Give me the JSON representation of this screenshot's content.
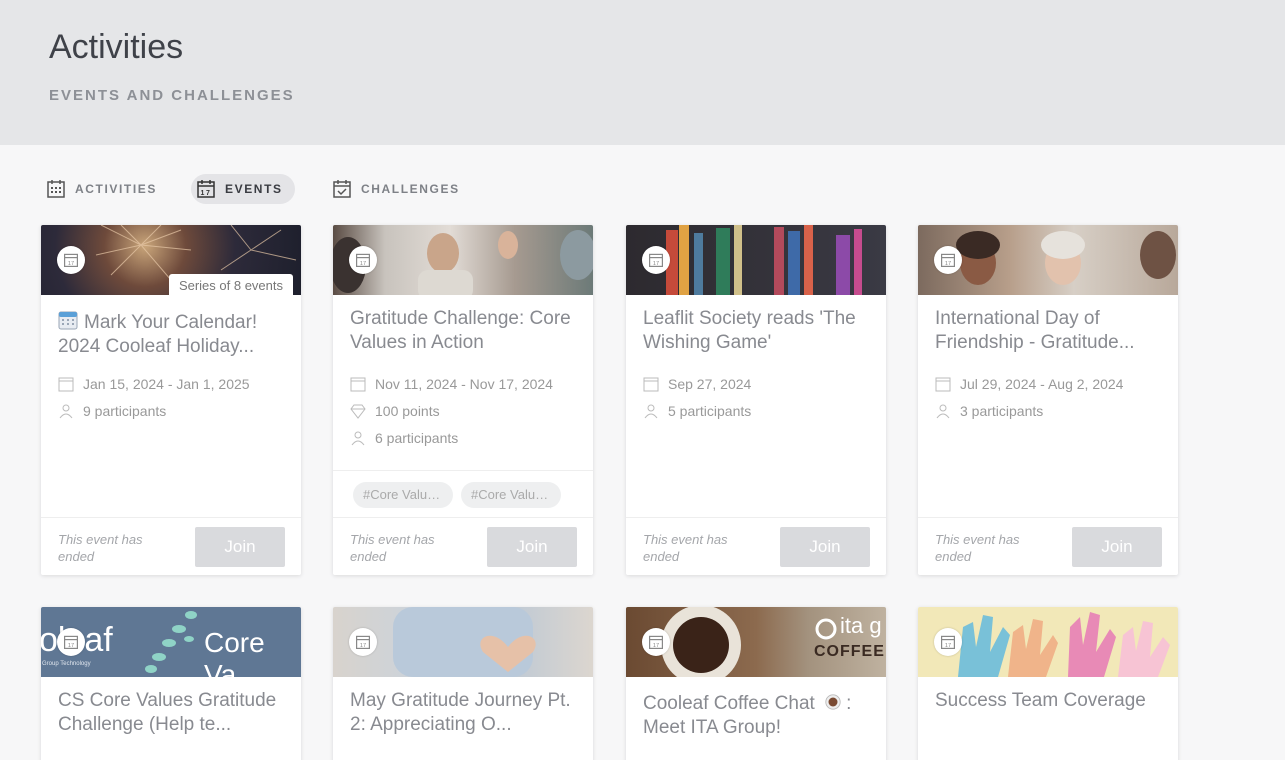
{
  "header": {
    "title": "Activities",
    "subtitle": "EVENTS AND CHALLENGES"
  },
  "tabs": [
    {
      "label": "ACTIVITIES",
      "icon": "grid-calendar-icon"
    },
    {
      "label": "EVENTS",
      "icon": "calendar-17-icon",
      "active": true
    },
    {
      "label": "CHALLENGES",
      "icon": "calendar-check-icon"
    }
  ],
  "cards": [
    {
      "title_emoji": "calendar-emoji-icon",
      "title": "Mark Your Calendar! 2024 Cooleaf Holiday...",
      "series": "Series of 8 events",
      "dates": "Jan 15, 2024 - Jan 1, 2025",
      "participants": "9 participants",
      "status": "This event has ended",
      "join": "Join"
    },
    {
      "title": "Gratitude Challenge: Core Values in Action",
      "dates": "Nov 11, 2024 - Nov 17, 2024",
      "points": "100 points",
      "participants": "6 participants",
      "tags": [
        "#Core Values...",
        "#Core Values..."
      ],
      "status": "This event has ended",
      "join": "Join"
    },
    {
      "title": "Leaflit Society reads 'The Wishing Game'",
      "dates": "Sep 27, 2024",
      "participants": "5 participants",
      "status": "This event has ended",
      "join": "Join"
    },
    {
      "title": "International Day of Friendship - Gratitude...",
      "dates": "Jul 29, 2024 - Aug 2, 2024",
      "participants": "3 participants",
      "status": "This event has ended",
      "join": "Join"
    },
    {
      "title": "CS Core Values Gratitude Challenge (Help te...",
      "banner_text": "oleaf",
      "banner_text2": "Core Va",
      "banner_small": "Group Technology"
    },
    {
      "title": "May Gratitude Journey Pt. 2: Appreciating O..."
    },
    {
      "title": "Cooleaf Coffee Chat",
      "title_suffix": ": Meet ITA Group!",
      "banner_text": "ita g",
      "banner_text2": "COFFEE"
    },
    {
      "title": "Success Team Coverage"
    }
  ],
  "colors": {
    "header_bg": "#e5e6e8",
    "page_bg": "#f7f7f8",
    "join_disabled": "#d9dadd"
  }
}
